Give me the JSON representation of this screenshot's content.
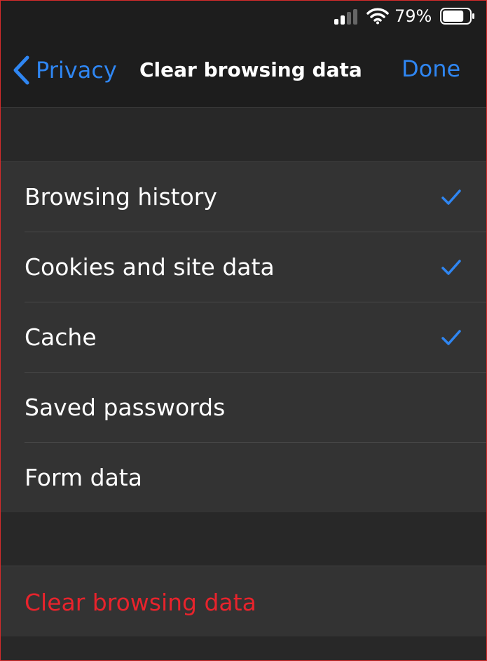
{
  "status_bar": {
    "battery_percent": "79%",
    "signal_icon": "cellular-signal-icon",
    "wifi_icon": "wifi-icon",
    "battery_icon": "battery-icon",
    "battery_level": 0.79
  },
  "nav": {
    "back_label": "Privacy",
    "back_icon": "chevron-left-icon",
    "title": "Clear browsing data",
    "done_label": "Done"
  },
  "options": [
    {
      "label": "Browsing history",
      "checked": true
    },
    {
      "label": "Cookies and site data",
      "checked": true
    },
    {
      "label": "Cache",
      "checked": true
    },
    {
      "label": "Saved passwords",
      "checked": false
    },
    {
      "label": "Form data",
      "checked": false
    }
  ],
  "clear_action": {
    "label": "Clear browsing data"
  },
  "colors": {
    "accent": "#2f86f2",
    "destructive": "#e8232c",
    "background": "#282828",
    "cell": "#333333",
    "bar": "#1d1d1d"
  }
}
